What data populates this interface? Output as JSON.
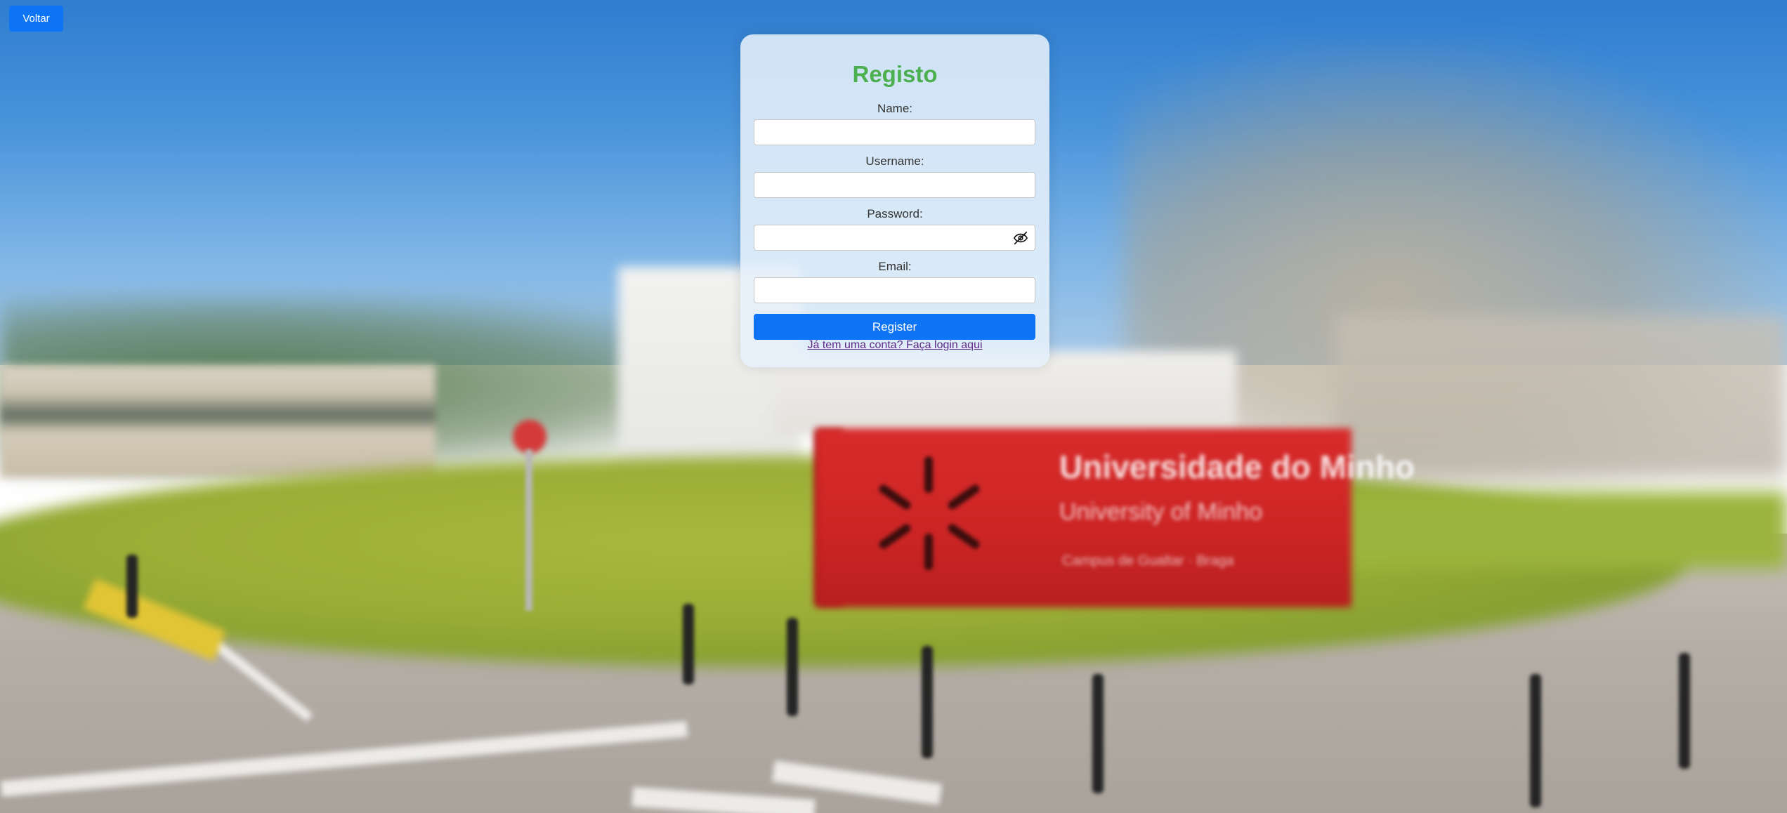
{
  "back_button": {
    "label": "Voltar"
  },
  "form": {
    "title": "Registo",
    "fields": {
      "name": {
        "label": "Name:",
        "value": "",
        "placeholder": ""
      },
      "username": {
        "label": "Username:",
        "value": "",
        "placeholder": ""
      },
      "password": {
        "label": "Password:",
        "value": "",
        "placeholder": "",
        "toggle_icon": "eye-slash-icon"
      },
      "email": {
        "label": "Email:",
        "value": "",
        "placeholder": ""
      }
    },
    "submit_label": "Register",
    "login_link": "Já tem uma conta? Faça login aqui"
  },
  "background": {
    "sign_line1": "Universidade do Minho",
    "sign_line2": "University of Minho",
    "sign_line3": "Campus de Gualtar · Braga"
  },
  "colors": {
    "primary": "#0d74f5",
    "title": "#4caf50",
    "link": "#5b2a86",
    "card_bg": "#e6f0fa",
    "sign_red": "#d82b2b"
  }
}
